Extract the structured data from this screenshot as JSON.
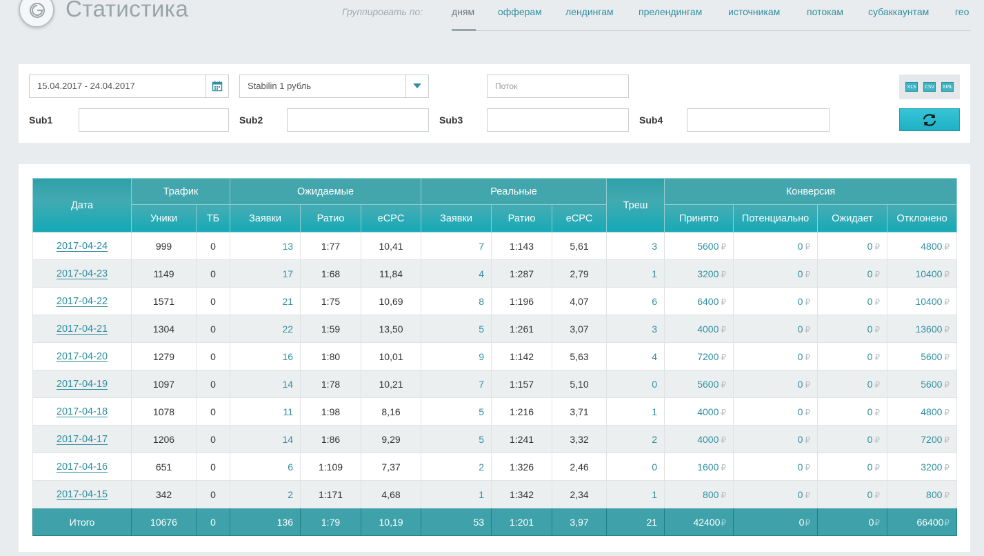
{
  "header": {
    "title": "Статистика",
    "group_by_label": "Группировать по:",
    "group_links": [
      "дням",
      "офферам",
      "лендингам",
      "прелендингам",
      "источникам",
      "потокам",
      "субаккаунтам",
      "гео"
    ],
    "active_group": "дням"
  },
  "filters": {
    "date_range": "15.04.2017 - 24.04.2017",
    "offer_select": "Stabilin 1 рубль",
    "stream_placeholder": "Поток",
    "sub_labels": [
      "Sub1",
      "Sub2",
      "Sub3",
      "Sub4"
    ],
    "export_icons": [
      "XLS",
      "CSV",
      "XML"
    ]
  },
  "table": {
    "group_headers": {
      "date": "Дата",
      "traffic": "Трафик",
      "expected": "Ожидаемые",
      "real": "Реальные",
      "trash": "Треш",
      "conversion": "Конверсия"
    },
    "sub_headers": {
      "uniques": "Уники",
      "tb": "ТБ",
      "exp_leads": "Заявки",
      "exp_ratio": "Ратио",
      "exp_ecpc": "eCPC",
      "real_leads": "Заявки",
      "real_ratio": "Ратио",
      "real_ecpc": "eCPC",
      "accepted": "Принято",
      "potential": "Потенциально",
      "waiting": "Ожидает",
      "rejected": "Отклонено"
    },
    "currency_symbol": "₽",
    "rows": [
      {
        "date": "2017-04-24",
        "uniques": "999",
        "tb": "0",
        "exp_leads": "13",
        "exp_ratio": "1:77",
        "exp_ecpc": "10,41",
        "real_leads": "7",
        "real_ratio": "1:143",
        "real_ecpc": "5,61",
        "trash": "3",
        "accepted": "5600",
        "potential": "0",
        "waiting": "0",
        "rejected": "4800"
      },
      {
        "date": "2017-04-23",
        "uniques": "1149",
        "tb": "0",
        "exp_leads": "17",
        "exp_ratio": "1:68",
        "exp_ecpc": "11,84",
        "real_leads": "4",
        "real_ratio": "1:287",
        "real_ecpc": "2,79",
        "trash": "1",
        "accepted": "3200",
        "potential": "0",
        "waiting": "0",
        "rejected": "10400"
      },
      {
        "date": "2017-04-22",
        "uniques": "1571",
        "tb": "0",
        "exp_leads": "21",
        "exp_ratio": "1:75",
        "exp_ecpc": "10,69",
        "real_leads": "8",
        "real_ratio": "1:196",
        "real_ecpc": "4,07",
        "trash": "6",
        "accepted": "6400",
        "potential": "0",
        "waiting": "0",
        "rejected": "10400"
      },
      {
        "date": "2017-04-21",
        "uniques": "1304",
        "tb": "0",
        "exp_leads": "22",
        "exp_ratio": "1:59",
        "exp_ecpc": "13,50",
        "real_leads": "5",
        "real_ratio": "1:261",
        "real_ecpc": "3,07",
        "trash": "3",
        "accepted": "4000",
        "potential": "0",
        "waiting": "0",
        "rejected": "13600"
      },
      {
        "date": "2017-04-20",
        "uniques": "1279",
        "tb": "0",
        "exp_leads": "16",
        "exp_ratio": "1:80",
        "exp_ecpc": "10,01",
        "real_leads": "9",
        "real_ratio": "1:142",
        "real_ecpc": "5,63",
        "trash": "4",
        "accepted": "7200",
        "potential": "0",
        "waiting": "0",
        "rejected": "5600"
      },
      {
        "date": "2017-04-19",
        "uniques": "1097",
        "tb": "0",
        "exp_leads": "14",
        "exp_ratio": "1:78",
        "exp_ecpc": "10,21",
        "real_leads": "7",
        "real_ratio": "1:157",
        "real_ecpc": "5,10",
        "trash": "0",
        "accepted": "5600",
        "potential": "0",
        "waiting": "0",
        "rejected": "5600"
      },
      {
        "date": "2017-04-18",
        "uniques": "1078",
        "tb": "0",
        "exp_leads": "11",
        "exp_ratio": "1:98",
        "exp_ecpc": "8,16",
        "real_leads": "5",
        "real_ratio": "1:216",
        "real_ecpc": "3,71",
        "trash": "1",
        "accepted": "4000",
        "potential": "0",
        "waiting": "0",
        "rejected": "4800"
      },
      {
        "date": "2017-04-17",
        "uniques": "1206",
        "tb": "0",
        "exp_leads": "14",
        "exp_ratio": "1:86",
        "exp_ecpc": "9,29",
        "real_leads": "5",
        "real_ratio": "1:241",
        "real_ecpc": "3,32",
        "trash": "2",
        "accepted": "4000",
        "potential": "0",
        "waiting": "0",
        "rejected": "7200"
      },
      {
        "date": "2017-04-16",
        "uniques": "651",
        "tb": "0",
        "exp_leads": "6",
        "exp_ratio": "1:109",
        "exp_ecpc": "7,37",
        "real_leads": "2",
        "real_ratio": "1:326",
        "real_ecpc": "2,46",
        "trash": "0",
        "accepted": "1600",
        "potential": "0",
        "waiting": "0",
        "rejected": "3200"
      },
      {
        "date": "2017-04-15",
        "uniques": "342",
        "tb": "0",
        "exp_leads": "2",
        "exp_ratio": "1:171",
        "exp_ecpc": "4,68",
        "real_leads": "1",
        "real_ratio": "1:342",
        "real_ecpc": "2,34",
        "trash": "1",
        "accepted": "800",
        "potential": "0",
        "waiting": "0",
        "rejected": "800"
      }
    ],
    "totals": {
      "date": "Итого",
      "uniques": "10676",
      "tb": "0",
      "exp_leads": "136",
      "exp_ratio": "1:79",
      "exp_ecpc": "10,19",
      "real_leads": "53",
      "real_ratio": "1:201",
      "real_ecpc": "3,97",
      "trash": "21",
      "accepted": "42400",
      "potential": "0",
      "waiting": "0",
      "rejected": "66400"
    }
  },
  "colors": {
    "accent": "#2f8fa0",
    "header_bg": "#3fa5ad",
    "refresh_button": "#1fb0c4",
    "page_bg": "#e9ecee"
  }
}
